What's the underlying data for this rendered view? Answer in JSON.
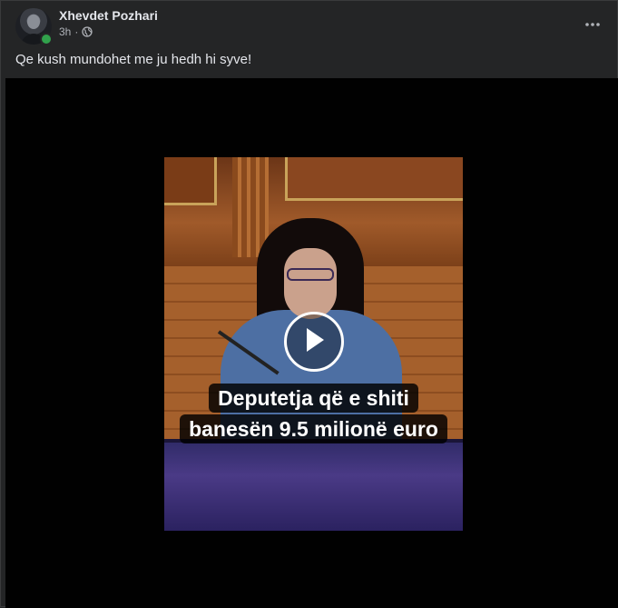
{
  "post": {
    "author": "Xhevdet Pozhari",
    "time": "3h",
    "separator": "·",
    "audience_icon": "globe-icon",
    "more_icon": "more-horizontal-icon",
    "text": "Qe kush mundohet me ju hedh hi syve!"
  },
  "video": {
    "caption_line1": "Deputetja që e shiti",
    "caption_line2": "banesën 9.5 milionë euro",
    "play_icon": "play-icon"
  },
  "colors": {
    "background": "#242526",
    "online": "#31a24c",
    "text_primary": "#e4e6eb",
    "text_secondary": "#b0b3b8"
  }
}
